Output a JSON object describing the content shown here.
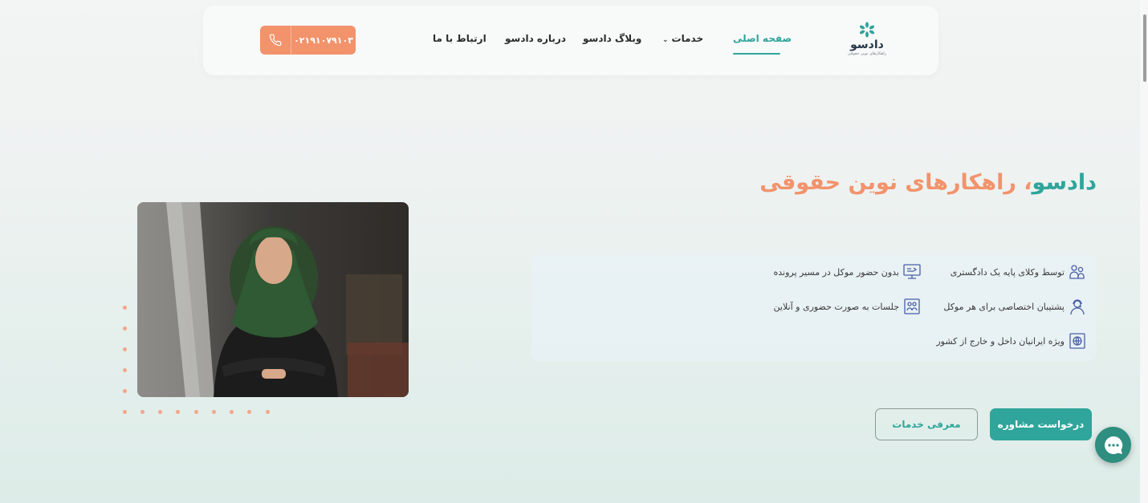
{
  "header": {
    "logo": {
      "name": "دادسو",
      "tagline": "راهکارهای نوین حقوقی"
    },
    "nav": [
      {
        "label": "صفحه اصلی"
      },
      {
        "label": "خدمات"
      },
      {
        "label": "وبلاگ دادسو"
      },
      {
        "label": "درباره دادسو"
      },
      {
        "label": "ارتباط با ما"
      }
    ],
    "phone": "۰۲۱۹۱۰۷۹۱۰۳"
  },
  "hero": {
    "brand": "دادسو",
    "separator": "،",
    "tagline": " راهکارهای نوین حقوقی",
    "features": [
      {
        "label": "توسط وکلای پایه یک دادگستری",
        "icon": "lawyers-icon"
      },
      {
        "label": "بدون حضور موکل در مسیر پرونده",
        "icon": "online-case-icon"
      },
      {
        "label": "پشتیبان اختصاصی برای هر موکل",
        "icon": "support-agent-icon"
      },
      {
        "label": "جلسات به صورت حضوری و آنلاین",
        "icon": "meeting-icon"
      },
      {
        "label": "ویژه ایرانیان داخل و خارج از کشور",
        "icon": "global-icon"
      }
    ],
    "primary_button": "درخواست مشاوره",
    "secondary_button": "معرفی خدمات"
  },
  "colors": {
    "accent": "#2fa59b",
    "orange": "#f2936c",
    "chat": "#2e8e80"
  }
}
